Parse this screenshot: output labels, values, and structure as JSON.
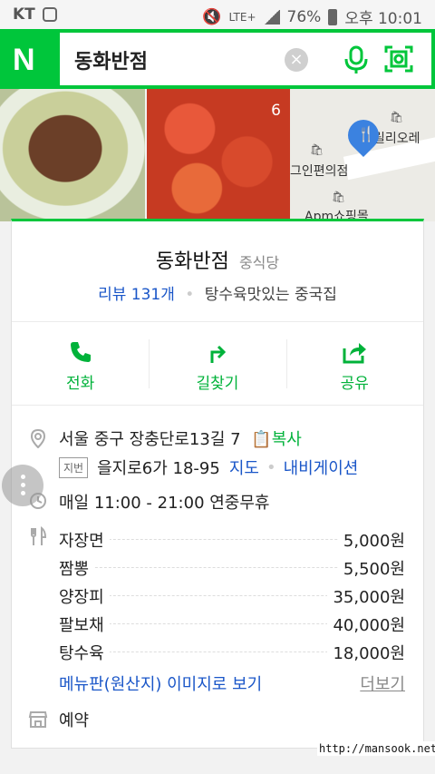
{
  "status_bar": {
    "carrier": "KT",
    "network": "LTE+",
    "battery": "76%",
    "time": "오후 10:01"
  },
  "search": {
    "logo": "N",
    "query": "동화반점",
    "clear_icon": "close-icon",
    "mic_icon": "mic-icon",
    "lens_icon": "lens-icon"
  },
  "photos": {
    "count": "6",
    "map_labels": [
      "릴리오레",
      "그인편의점",
      "Apm쇼핑몰"
    ]
  },
  "place": {
    "name": "동화반점",
    "category": "중식당",
    "reviews": "리뷰 131개",
    "tagline": "탕수육맛있는 중국집"
  },
  "actions": [
    {
      "label": "전화",
      "icon": "phone-icon"
    },
    {
      "label": "길찾기",
      "icon": "directions-icon"
    },
    {
      "label": "공유",
      "icon": "share-icon"
    }
  ],
  "info": {
    "address": "서울 중구 장충단로13길 7",
    "copy_label": "복사",
    "jibun_badge": "지번",
    "jibun_address": "을지로6가 18-95",
    "map_link": "지도",
    "navigation_link": "내비게이션",
    "hours": "매일 11:00 - 21:00 연중무휴"
  },
  "menu": {
    "items": [
      {
        "name": "자장면",
        "price": "5,000원"
      },
      {
        "name": "짬뽕",
        "price": "5,500원"
      },
      {
        "name": "양장피",
        "price": "35,000원"
      },
      {
        "name": "팔보채",
        "price": "40,000원"
      },
      {
        "name": "탕수육",
        "price": "18,000원"
      }
    ],
    "image_link": "메뉴판(원산지) 이미지로 보기",
    "more_label": "더보기"
  },
  "reservation": "예약",
  "watermark": "http://mansook.net",
  "colors": {
    "brand_green": "#00c63b",
    "link_blue": "#1a56c8"
  }
}
